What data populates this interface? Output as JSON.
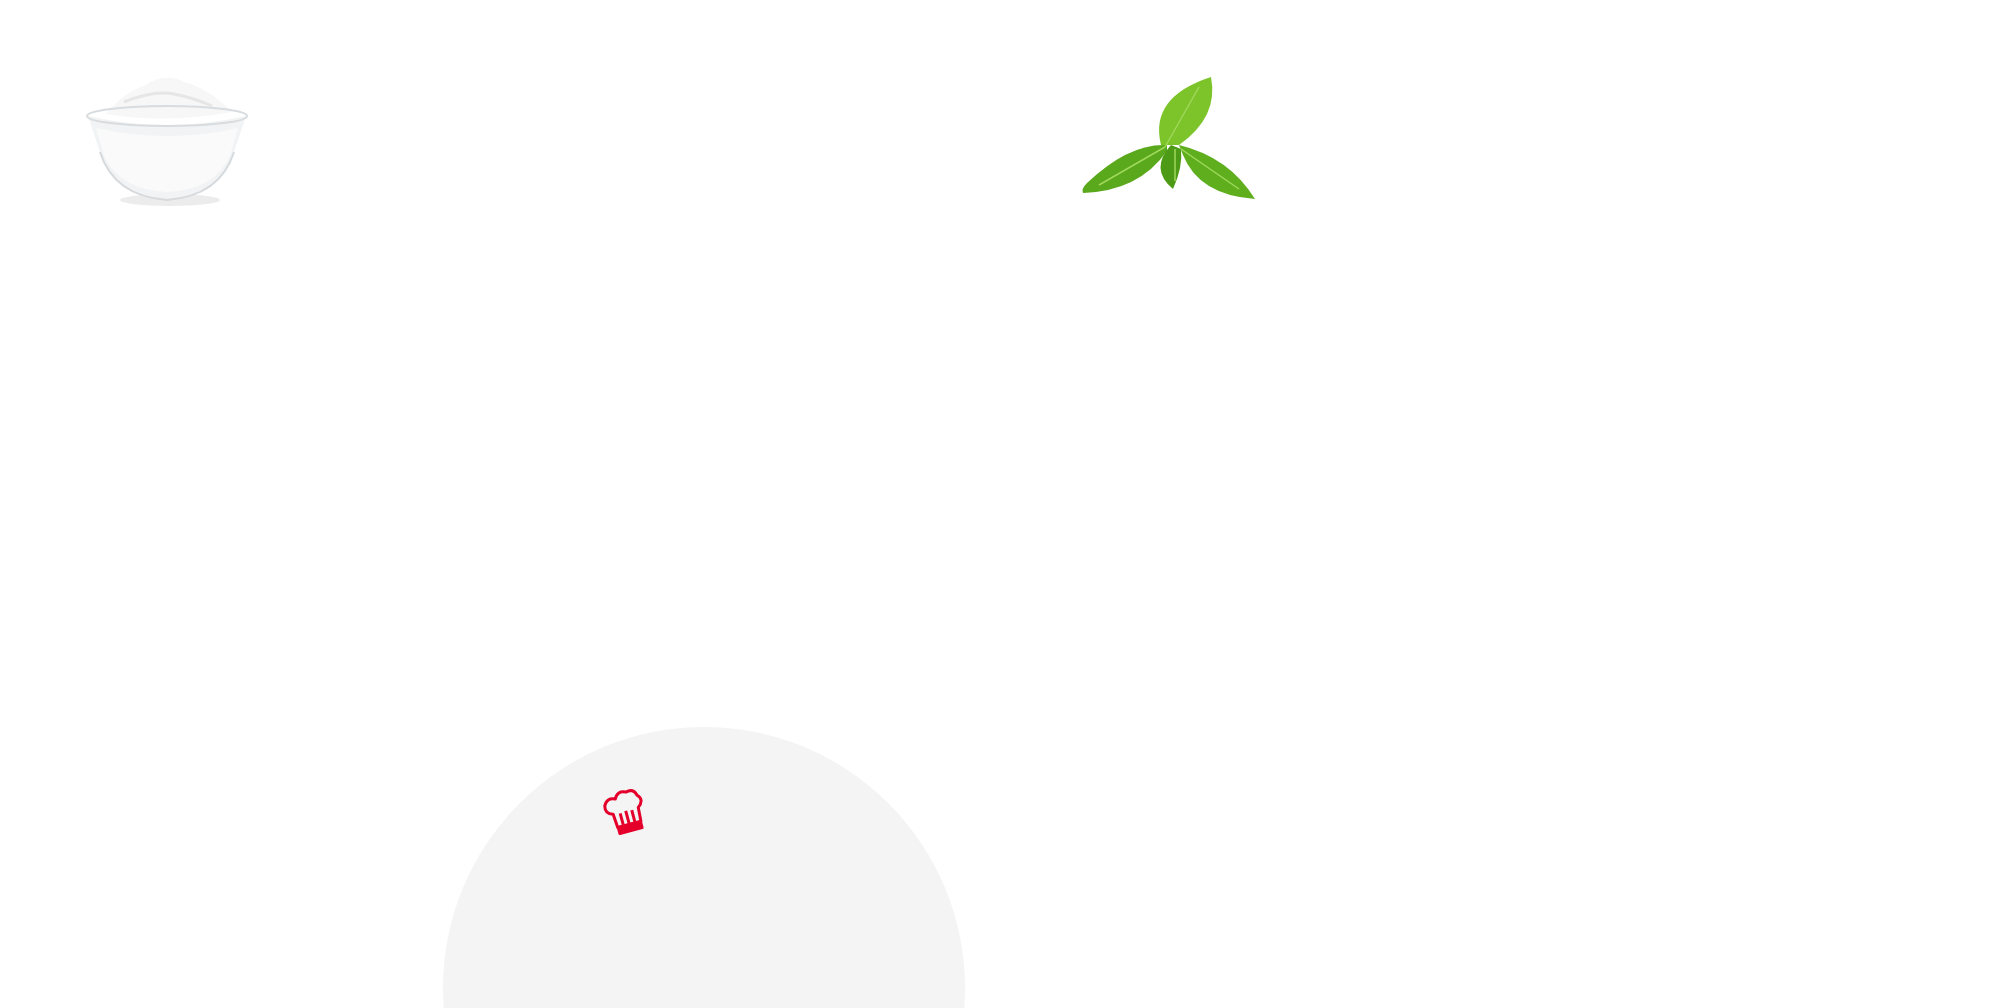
{
  "badge": {
    "kind": "chef-hat"
  }
}
